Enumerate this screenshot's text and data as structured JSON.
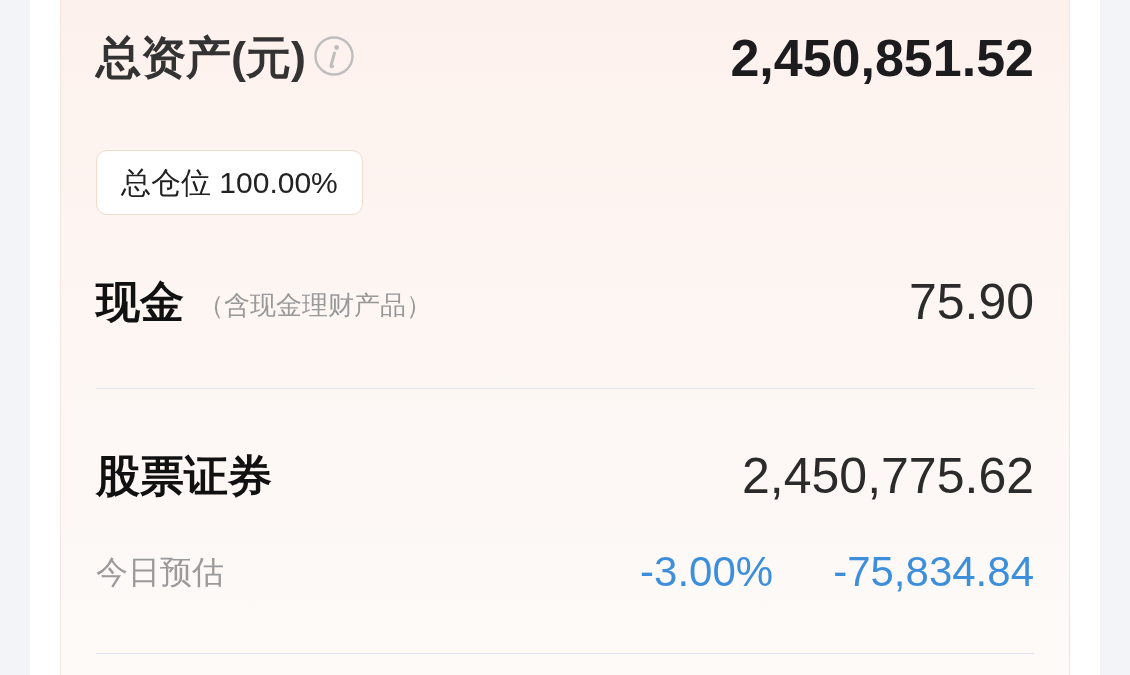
{
  "total_assets": {
    "label": "总资产(元)",
    "value": "2,450,851.52"
  },
  "position_tag": "总仓位 100.00%",
  "sections": [
    {
      "label": "现金",
      "note": "（含现金理财产品）",
      "value": "75.90"
    },
    {
      "label": "股票证券",
      "value": "2,450,775.62",
      "estimate": {
        "label": "今日预估",
        "negative": true,
        "percent": "-3.00%",
        "amount": "-75,834.84"
      }
    }
  ]
}
